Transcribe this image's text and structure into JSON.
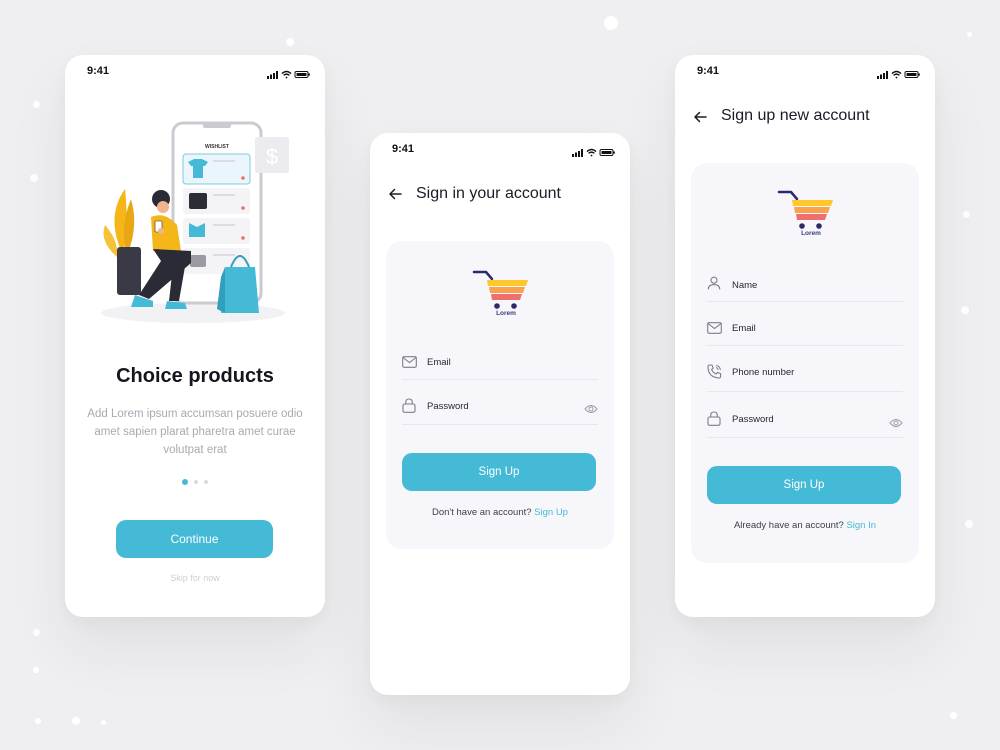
{
  "colors": {
    "background": "#efeff1",
    "accent": "#45bad6",
    "title": "#15151f",
    "muted": "#a9a9b3",
    "card": "#f7f7fb",
    "logo_stripes": [
      "#ffc72c",
      "#f8a24d",
      "#ef6f6c"
    ],
    "logo_handle": "#2b2a6b"
  },
  "onboarding": {
    "status_time": "9:41",
    "illustration_label": "WISHLIST",
    "title": "Choice products",
    "description": "Add Lorem ipsum accumsan posuere odio amet sapien plarat pharetra amet curae volutpat erat",
    "pager_active_index": 0,
    "continue_label": "Continue",
    "skip_label": "Skip for now"
  },
  "signin": {
    "status_time": "9:41",
    "title": "Sign in your account",
    "logo_text": "Lorem",
    "fields": [
      {
        "icon": "mail-icon",
        "label": "Email"
      },
      {
        "icon": "lock-icon",
        "label": "Password",
        "trailing_icon": "eye-icon"
      }
    ],
    "button_label": "Sign Up",
    "footer_text": "Don't have an account?",
    "footer_link": "Sign Up"
  },
  "signup": {
    "status_time": "9:41",
    "title": "Sign up new account",
    "logo_text": "Lorem",
    "fields": [
      {
        "icon": "user-icon",
        "label": "Name"
      },
      {
        "icon": "mail-icon",
        "label": "Email"
      },
      {
        "icon": "phone-icon",
        "label": "Phone number"
      },
      {
        "icon": "lock-icon",
        "label": "Password",
        "trailing_icon": "eye-icon"
      }
    ],
    "button_label": "Sign Up",
    "footer_text": "Already have an account?",
    "footer_link": "Sign In"
  }
}
